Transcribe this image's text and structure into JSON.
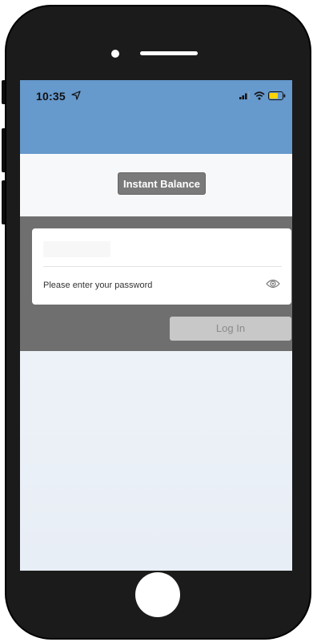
{
  "status_bar": {
    "time": "10:35",
    "icons": [
      "location-arrow-icon",
      "cellular-signal-icon",
      "wifi-icon",
      "battery-icon"
    ],
    "battery_color": "#ffd400"
  },
  "header": {
    "color": "#6699cc"
  },
  "app": {
    "title": "Instant Balance"
  },
  "login_form": {
    "username_value": "",
    "password_placeholder": "Please enter your password",
    "show_password_icon": "eye-icon",
    "login_label": "Log In"
  }
}
